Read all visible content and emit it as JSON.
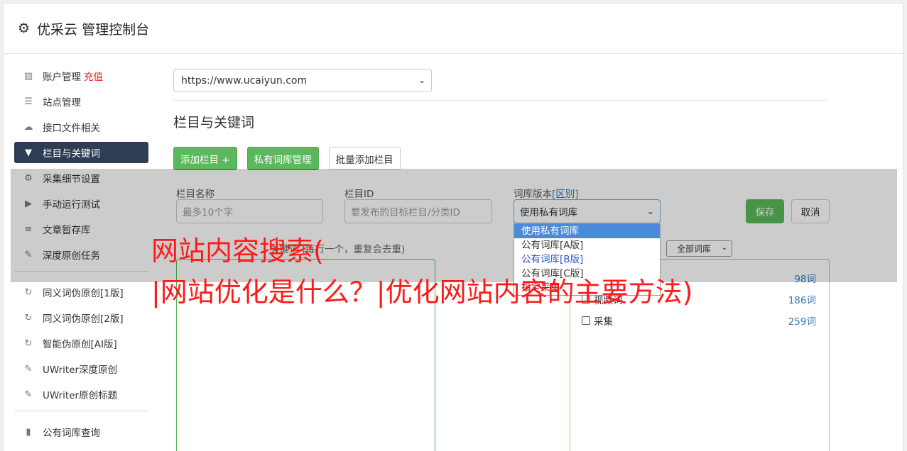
{
  "header": {
    "title": "优采云 管理控制台"
  },
  "sidebar": {
    "items": [
      {
        "label": "账户管理",
        "extra": "充值",
        "icon": "bar-chart-icon"
      },
      {
        "label": "站点管理",
        "icon": "server-icon"
      },
      {
        "label": "接口文件相关",
        "icon": "cloud-upload-icon"
      },
      {
        "label": "栏目与关键词",
        "icon": "filter-icon",
        "active": true
      },
      {
        "label": "采集细节设置",
        "icon": "gears-icon"
      },
      {
        "label": "手动运行测试",
        "icon": "play-icon"
      },
      {
        "label": "文章暂存库",
        "icon": "database-icon"
      },
      {
        "label": "深度原创任务",
        "icon": "edit-icon"
      },
      {
        "label": "同义词伪原创[1版]",
        "icon": "refresh-icon"
      },
      {
        "label": "同义词伪原创[2版]",
        "icon": "refresh-icon"
      },
      {
        "label": "智能伪原创[AI版]",
        "icon": "refresh-icon"
      },
      {
        "label": "UWriter深度原创",
        "icon": "edit-icon"
      },
      {
        "label": "UWriter原创标题",
        "icon": "edit-icon"
      },
      {
        "label": "公有词库查询",
        "icon": "book-icon"
      }
    ]
  },
  "main": {
    "site_select_value": "https://www.ucaiyun.com",
    "section_title": "栏目与关键词",
    "buttons": {
      "add_column": "添加栏目 +",
      "private_lib": "私有词库管理",
      "batch_add": "批量添加栏目"
    }
  },
  "form": {
    "column_name_label": "栏目名称",
    "column_name_placeholder": "最多10个字",
    "column_id_label": "栏目ID",
    "column_id_placeholder": "要发布的目标栏目/分类ID",
    "lib_version_label": "词库版本",
    "lib_version_link": "[区别]",
    "lib_version_value": "使用私有词库",
    "save": "保存",
    "cancel": "取消"
  },
  "dropdown": {
    "options": [
      "使用私有词库",
      "公有词库[A版]",
      "公有词库[B版]",
      "公有词库[C版]",
      "指定采集"
    ]
  },
  "lists": {
    "left_hint": "关键词 (每行一个，重复会去重)",
    "filter_value": "全部词库",
    "libraries": [
      {
        "name": "",
        "count": "98词"
      },
      {
        "name": "视频词",
        "count": "186词"
      },
      {
        "name": "采集",
        "count": "259词"
      }
    ]
  },
  "watermark": {
    "line1": "网站内容搜索(",
    "line2": "|网站优化是什么？|优化网站内容的主要方法)"
  },
  "colors": {
    "accent_green": "#5cb85c",
    "sidebar_active": "#2f3d54",
    "recharge_red": "#e02020",
    "watermark_red": "#ff1a1a",
    "link_blue": "#337ab7"
  }
}
